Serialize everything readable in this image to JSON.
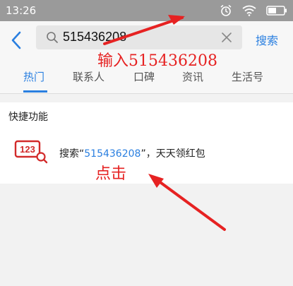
{
  "status_bar": {
    "time": "13:26"
  },
  "search": {
    "value": "515436208",
    "button_label": "搜索"
  },
  "tabs": [
    {
      "label": "热门"
    },
    {
      "label": "联系人"
    },
    {
      "label": "口碑"
    },
    {
      "label": "资讯"
    },
    {
      "label": "生活号"
    }
  ],
  "quick_section": {
    "title": "快捷功能",
    "item": {
      "icon_text": "123",
      "prefix": "搜索“",
      "highlight": "515436208",
      "suffix": "”，天天领红包"
    }
  },
  "annotations": {
    "input_note": "输入515436208",
    "click_note": "点击"
  },
  "colors": {
    "accent": "#2a7fe0",
    "annotation": "#e62222",
    "icon_red": "#d22a2a"
  }
}
